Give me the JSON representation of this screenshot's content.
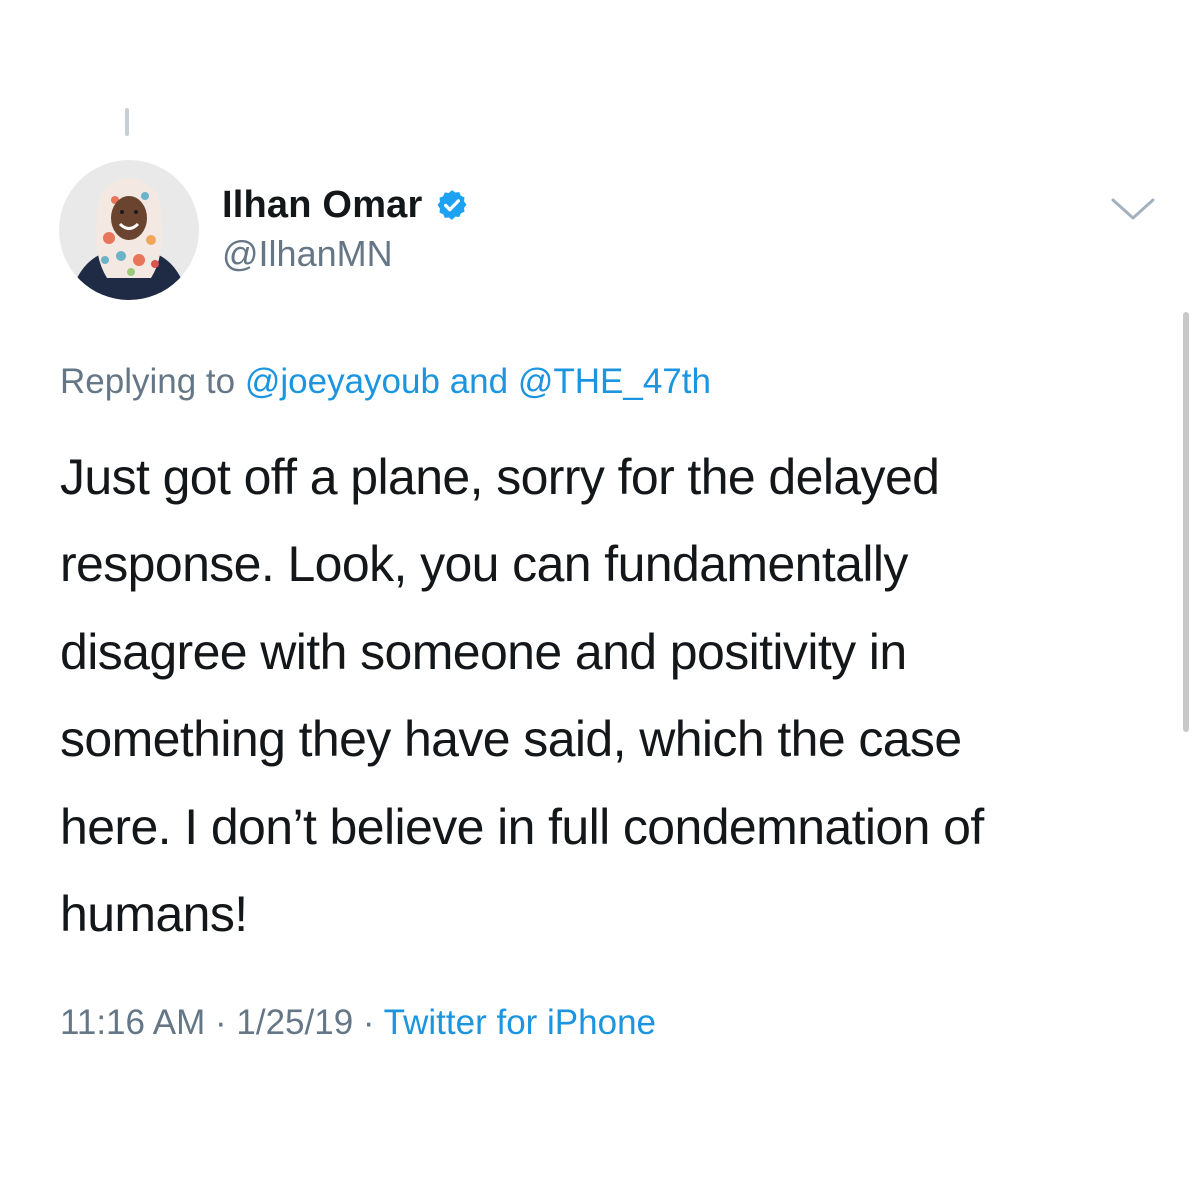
{
  "tweet": {
    "display_name": "Ilhan Omar",
    "verified": true,
    "handle": "@IlhanMN",
    "replying_prefix": "Replying to",
    "reply_mention_1": "@joeyayoub",
    "reply_joiner": "and",
    "reply_mention_2": "@THE_47th",
    "text_lines": [
      "Just got off a plane, sorry for the delayed",
      "response. Look, you can fundamentally",
      "disagree with someone and positivity in",
      "something they have said, which the case",
      "here. I don’t believe in full condemnation of",
      "humans!"
    ],
    "time": "11:16 AM",
    "separator": "·",
    "date": "1/25/19",
    "source": "Twitter for iPhone"
  },
  "icons": {
    "verified": "verified-badge-icon",
    "more": "chevron-down-icon"
  },
  "colors": {
    "text_primary": "#14171a",
    "text_secondary": "#657786",
    "link": "#1b95e0",
    "verified_badge": "#1da1f2"
  }
}
